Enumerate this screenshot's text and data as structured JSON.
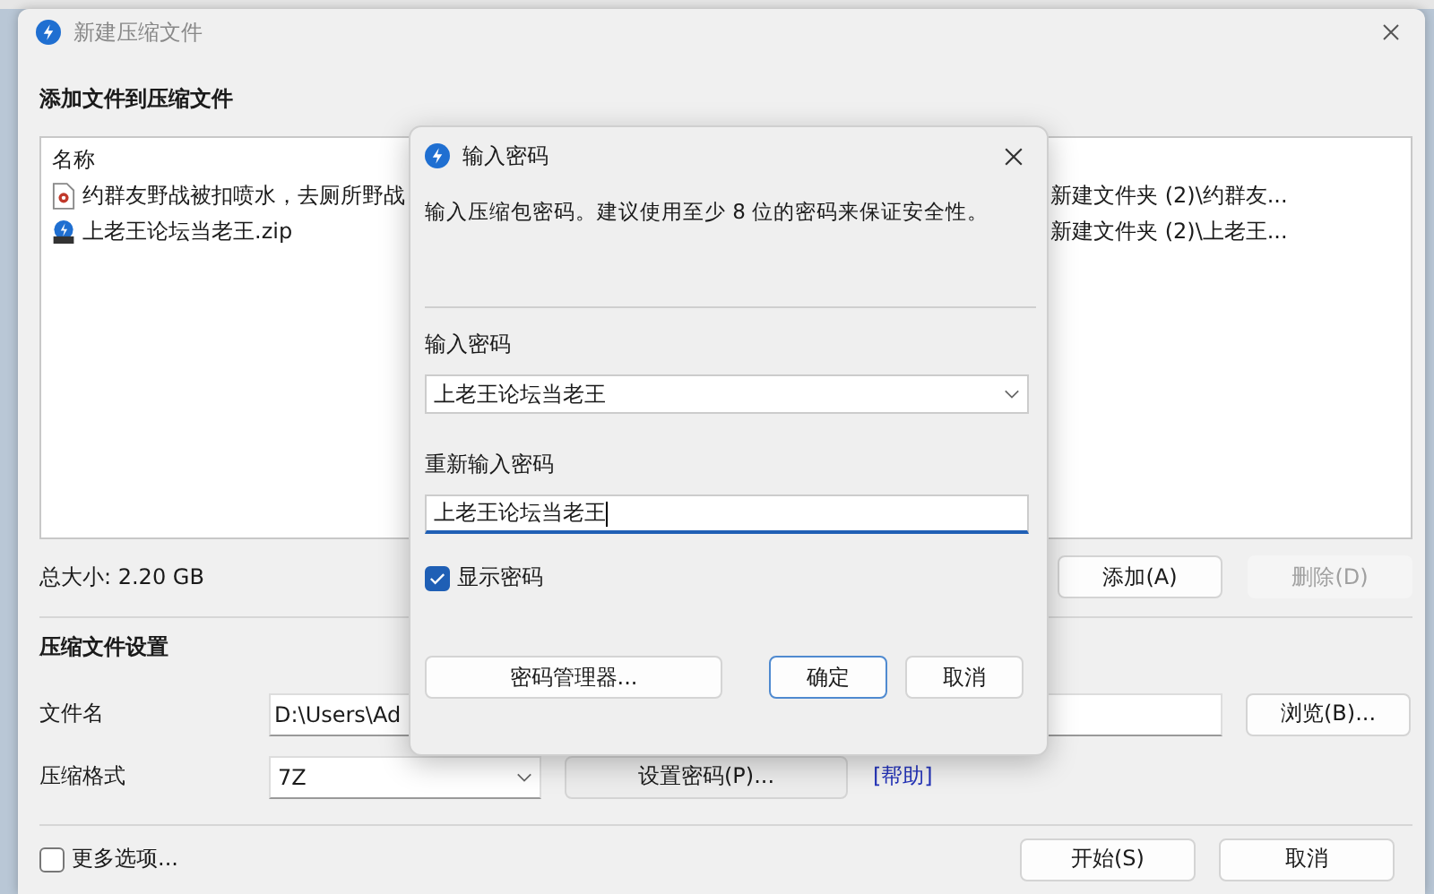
{
  "window": {
    "title": "新建压缩文件"
  },
  "section_add": "添加文件到压缩文件",
  "file_list": {
    "columns": [
      "名称"
    ],
    "rows": [
      {
        "name": "约群友野战被扣喷水，去厕所野战",
        "path": "新建文件夹 (2)\\约群友...",
        "kind": "video"
      },
      {
        "name": "上老王论坛当老王.zip",
        "path": "新建文件夹 (2)\\上老王...",
        "kind": "zip"
      }
    ]
  },
  "total_size": "总大小: 2.20 GB",
  "list_buttons": [
    {
      "label": "添加(A)",
      "disabled": false
    },
    {
      "label": "删除(D)",
      "disabled": true
    }
  ],
  "settings": {
    "heading": "压缩文件设置",
    "filename_label": "文件名",
    "filename_value": "D:\\Users\\Ad",
    "browse_button": "浏览(B)...",
    "format_label": "压缩格式",
    "format_value": "7Z",
    "password_button": "设置密码(P)...",
    "help_link": "[帮助]"
  },
  "more_options": {
    "label": "更多选项...",
    "checked": false
  },
  "footer_buttons": [
    "开始(S)",
    "取消"
  ],
  "dialog": {
    "title": "输入密码",
    "description": "输入压缩包密码。建议使用至少 8 位的密码来保证安全性。",
    "password_label": "输入密码",
    "password_value": "上老王论坛当老王",
    "confirm_label": "重新输入密码",
    "confirm_value": "上老王论坛当老王",
    "show_password": {
      "label": "显示密码",
      "checked": true
    },
    "buttons": [
      {
        "label": "密码管理器...",
        "default": false
      },
      {
        "label": "确定",
        "default": true
      },
      {
        "label": "取消",
        "default": false
      }
    ]
  }
}
